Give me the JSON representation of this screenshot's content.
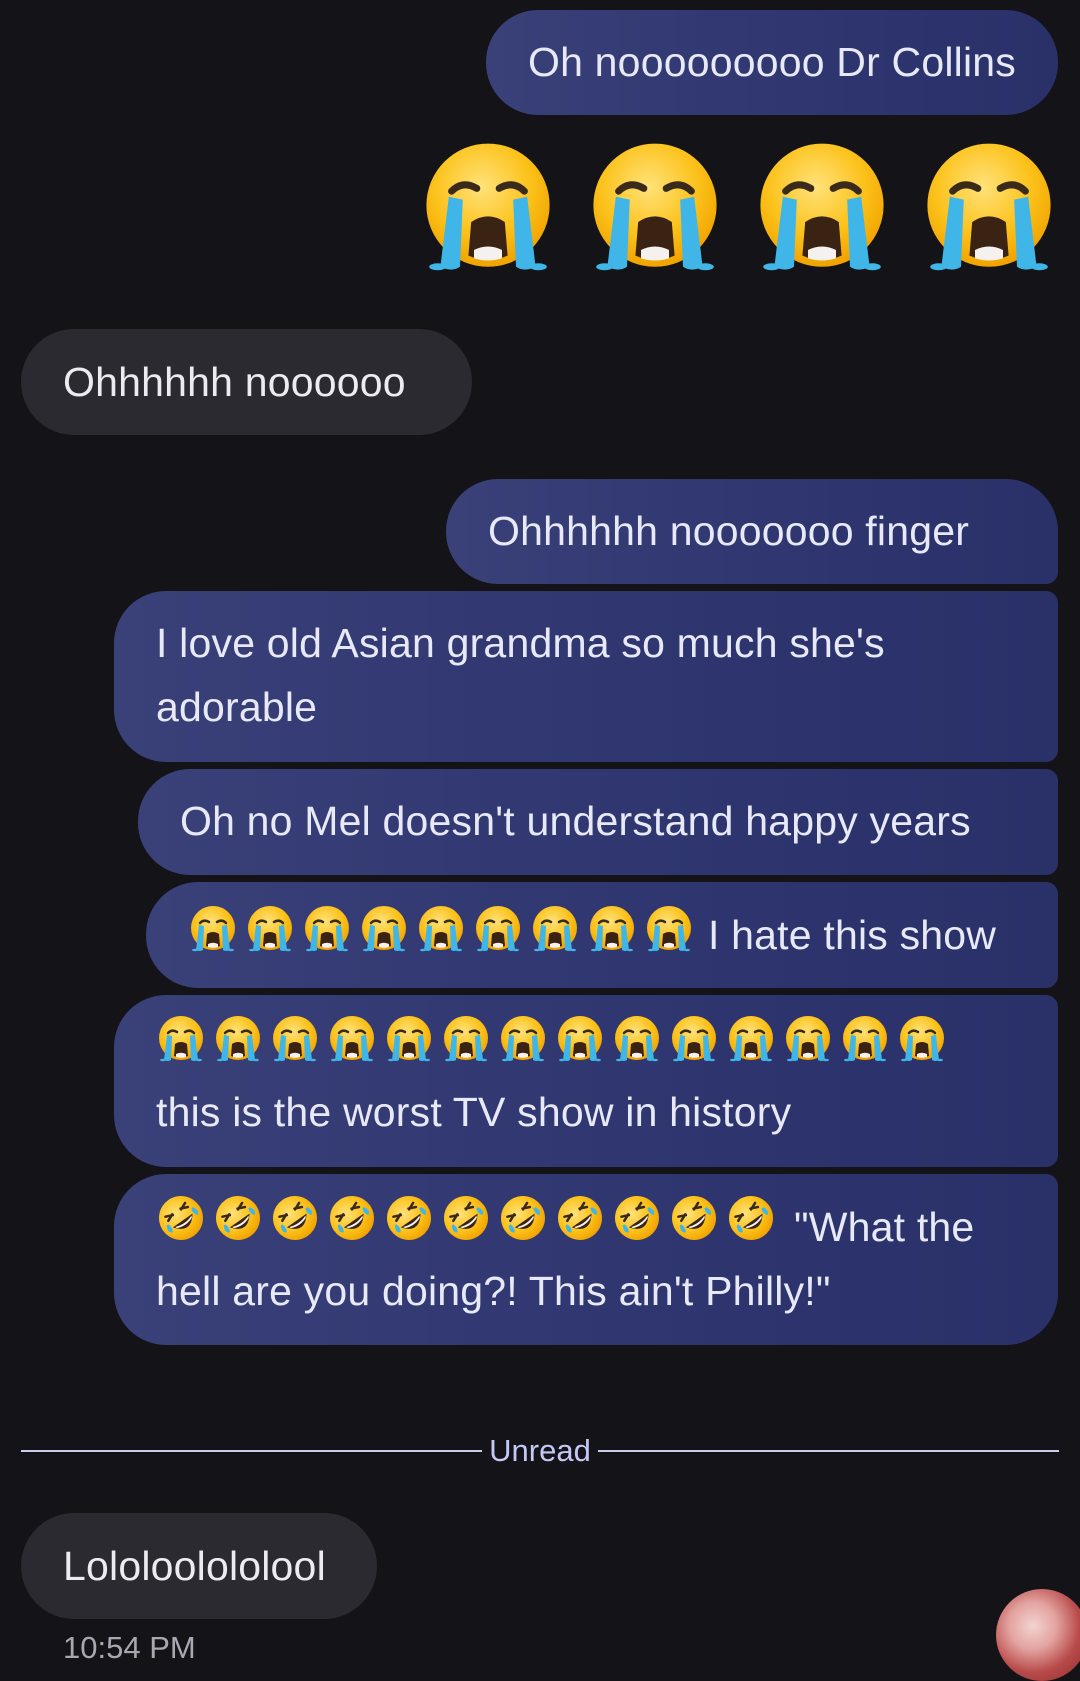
{
  "messages": {
    "m1": "Oh nooooooooo Dr Collins",
    "m3": "Ohhhhhh noooooo",
    "m4": "Ohhhhhh nooooooo finger",
    "m5_line1": "I love old Asian grandma so much she's",
    "m5_line2": "adorable",
    "m6": "Oh no Mel doesn't understand happy years",
    "m7_text": "I hate this show",
    "m8_line2": "this is the worst TV show in history",
    "m9_text": "\"What the",
    "m9_line2": "hell are you doing?! This ain't Philly!\"",
    "m10": "Lololoolololool"
  },
  "emoji": {
    "m2_big": {
      "icon": "loudly-crying-face-icon",
      "count": 4
    },
    "m7": {
      "icon": "loudly-crying-face-icon",
      "count": 9
    },
    "m8": {
      "icon": "loudly-crying-face-icon",
      "count": 14
    },
    "m9": {
      "icon": "rolling-on-floor-laughing-icon",
      "count": 11
    }
  },
  "divider": {
    "label": "Unread"
  },
  "timestamp": {
    "text": "10:54 PM"
  },
  "colors": {
    "background": "#131318",
    "outgoing_bubble": "#2f3670",
    "incoming_bubble": "#2a2a30",
    "divider": "#c9cdf2"
  }
}
